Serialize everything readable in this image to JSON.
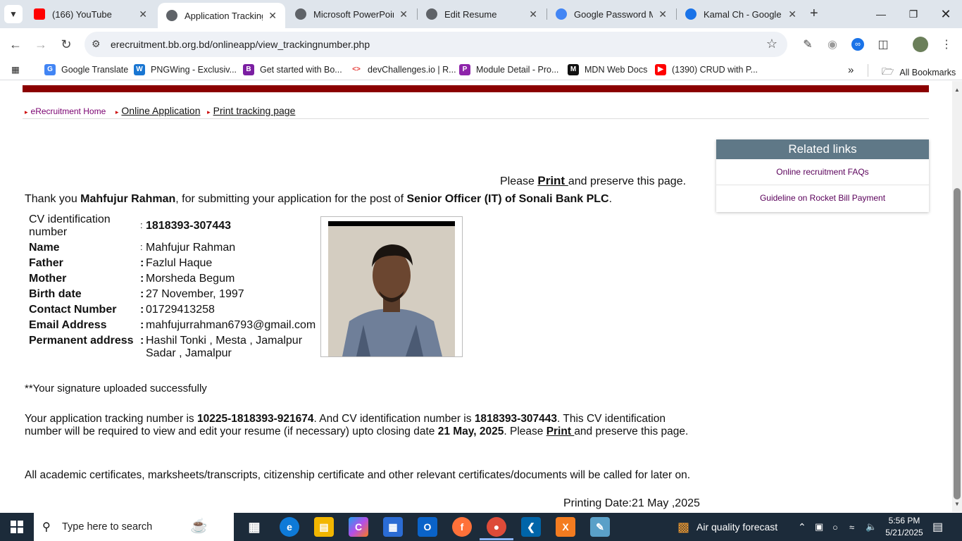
{
  "browser": {
    "tabs": [
      {
        "title": "(166) YouTube",
        "favicon_color": "#ff0000"
      },
      {
        "title": "Application Tracking N",
        "favicon_color": "#5f6368"
      },
      {
        "title": "Microsoft PowerPoint",
        "favicon_color": "#5f6368"
      },
      {
        "title": "Edit Resume",
        "favicon_color": "#5f6368"
      },
      {
        "title": "Google Password Ma",
        "favicon_color": "#4285f4"
      },
      {
        "title": "Kamal Ch - Google C",
        "favicon_color": "#1a73e8"
      }
    ],
    "url": "erecruitment.bb.org.bd/onlineapp/view_trackingnumber.php",
    "bookmarks": [
      {
        "label": "Google Translate",
        "color": "#4285f4"
      },
      {
        "label": "PNGWing - Exclusiv...",
        "color": "#1976d2"
      },
      {
        "label": "Get started with Bo...",
        "color": "#7b1fa2"
      },
      {
        "label": "devChallenges.io | R...",
        "color": "#e53935"
      },
      {
        "label": "Module Detail - Pro...",
        "color": "#8e24aa"
      },
      {
        "label": "MDN Web Docs",
        "color": "#111111"
      },
      {
        "label": "(1390) CRUD with P...",
        "color": "#ff0000"
      }
    ],
    "all_bookmarks": "All Bookmarks"
  },
  "page": {
    "breadcrumb": {
      "home": "eRecruitment Home",
      "online_app": "Online Application",
      "print_page": "Print tracking page"
    },
    "please_prefix": "Please ",
    "print_word": "Print ",
    "please_suffix": "and preserve this page.",
    "thanks": {
      "t1": "Thank you ",
      "name": "Mahfujur Rahman",
      "t2": ", for submitting your application for the post of ",
      "post": "Senior Officer (IT) of Sonali Bank PLC",
      "t3": "."
    },
    "info": {
      "cv_label": "CV identification number",
      "cv_value": "1818393-307443",
      "name_label": "Name",
      "name_value": "Mahfujur Rahman",
      "father_label": "Father",
      "father_value": "Fazlul Haque",
      "mother_label": "Mother",
      "mother_value": "Morsheda Begum",
      "birth_label": "Birth date",
      "birth_value": "27 November, 1997",
      "contact_label": "Contact Number",
      "contact_value": "01729413258",
      "email_label": "Email Address",
      "email_value": "mahfujurrahman6793@gmail.com",
      "address_label": "Permanent address",
      "address_value": "Hashil Tonki , Mesta , Jamalpur Sadar , Jamalpur",
      "colon": ":"
    },
    "signature": "**Your signature uploaded successfully",
    "tracking": {
      "p1": "Your application tracking number is ",
      "tracking_no": "10225-1818393-921674",
      "p2": ". And CV identification number is ",
      "cv_no": "1818393-307443",
      "p3": ". This CV identification number will be required to view and edit your resume (if necessary) upto closing date ",
      "closing": "21 May, 2025",
      "p4": ". Please ",
      "print": "Print ",
      "p5": "and preserve this page."
    },
    "certificates": "All academic certificates, marksheets/transcripts, citizenship certificate and other relevant certificates/documents will be called for later on.",
    "printing_date": "Printing Date:21 May ,2025",
    "related": {
      "header": "Related links",
      "links": [
        "Online recruitment FAQs",
        "Guideline on Rocket Bill Payment"
      ]
    }
  },
  "taskbar": {
    "search_placeholder": "Type here to search",
    "weather": "Air quality forecast",
    "time": "5:56 PM",
    "date": "5/21/2025"
  }
}
